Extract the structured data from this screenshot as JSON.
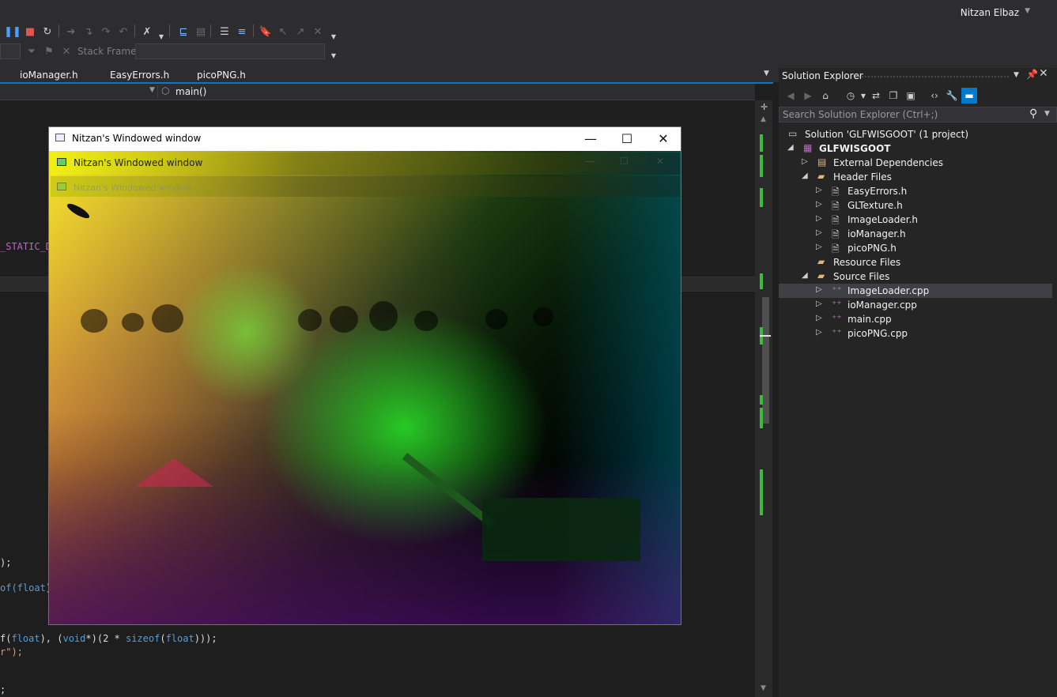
{
  "user": {
    "name": "Nitzan Elbaz"
  },
  "toolbar": {
    "stack_frame_label": "Stack Frame:",
    "pause_icon": "pause-icon",
    "stop_icon": "stop-icon",
    "restart_icon": "restart-icon"
  },
  "doc_tabs": [
    "ioManager.h",
    "EasyErrors.h",
    "picoPNG.h"
  ],
  "navbar": {
    "function": "main()"
  },
  "code_fragments": {
    "macro": "_STATIC_D",
    "line_a": ");",
    "line_b_pre": "of(",
    "line_b_kw": "float",
    "line_b_post": ")",
    "line_c_1": "f(",
    "line_c_2": "float",
    "line_c_3": "), (",
    "line_c_4": "void",
    "line_c_5": "*)(2 * ",
    "line_c_6": "sizeof",
    "line_c_7": "(",
    "line_c_8": "float",
    "line_c_9": ")));",
    "line_d": "r\");",
    "line_e": ";"
  },
  "solution_explorer": {
    "title": "Solution Explorer",
    "search_placeholder": "Search Solution Explorer (Ctrl+;)",
    "solution": "Solution 'GLFWISGOOT' (1 project)",
    "project": "GLFWISGOOT",
    "external": "External Dependencies",
    "header_folder": "Header Files",
    "headers": [
      "EasyErrors.h",
      "GLTexture.h",
      "ImageLoader.h",
      "ioManager.h",
      "picoPNG.h"
    ],
    "resource_folder": "Resource Files",
    "source_folder": "Source Files",
    "sources": [
      "ImageLoader.cpp",
      "ioManager.cpp",
      "main.cpp",
      "picoPNG.cpp"
    ],
    "selected_source": "ImageLoader.cpp"
  },
  "app_window": {
    "title": "Nitzan's Windowed window",
    "ghost_title_1": "Nitzan's Windowed window",
    "ghost_title_2": "Nitzan's Windowed window"
  },
  "colors": {
    "accent": "#007acc",
    "change_marker": "#3cbc3c",
    "macro": "#bd63c5",
    "keyword": "#569cd6"
  }
}
